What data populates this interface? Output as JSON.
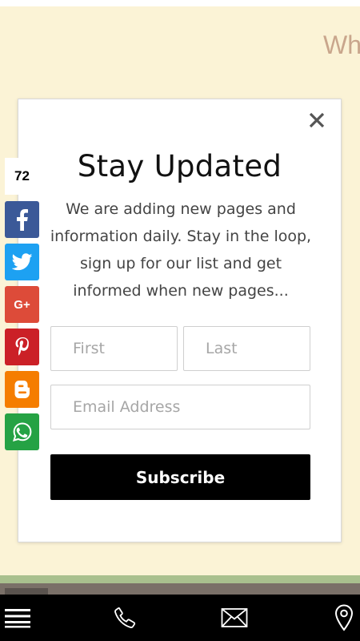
{
  "background": {
    "heading_fragment": "Wh",
    "page_color": "#fbf3d6"
  },
  "popup": {
    "title": "Stay Updated",
    "description": "We are adding new pages and information daily. Stay in the loop, sign up for our list and get informed when new pages...",
    "close_icon": "close-icon",
    "first_name": {
      "placeholder": "First",
      "value": ""
    },
    "last_name": {
      "placeholder": "Last",
      "value": ""
    },
    "email": {
      "placeholder": "Email Address",
      "value": ""
    },
    "subscribe_label": "Subscribe"
  },
  "share_bar": {
    "count": "72",
    "buttons": [
      {
        "network": "facebook",
        "icon": "facebook-icon",
        "color": "#3b5998"
      },
      {
        "network": "twitter",
        "icon": "twitter-icon",
        "color": "#1da1f2"
      },
      {
        "network": "google-plus",
        "icon": "google-plus-icon",
        "glyph": "G+",
        "color": "#dd4b39"
      },
      {
        "network": "pinterest",
        "icon": "pinterest-icon",
        "color": "#cb2027"
      },
      {
        "network": "blogger",
        "icon": "blogger-icon",
        "color": "#f57d00"
      },
      {
        "network": "whatsapp",
        "icon": "whatsapp-icon",
        "color": "#25a244"
      }
    ]
  },
  "bottom_nav": {
    "items": [
      {
        "name": "menu",
        "icon": "hamburger-menu-icon"
      },
      {
        "name": "call",
        "icon": "phone-icon"
      },
      {
        "name": "email",
        "icon": "mail-icon"
      },
      {
        "name": "location",
        "icon": "map-pin-icon"
      }
    ]
  }
}
